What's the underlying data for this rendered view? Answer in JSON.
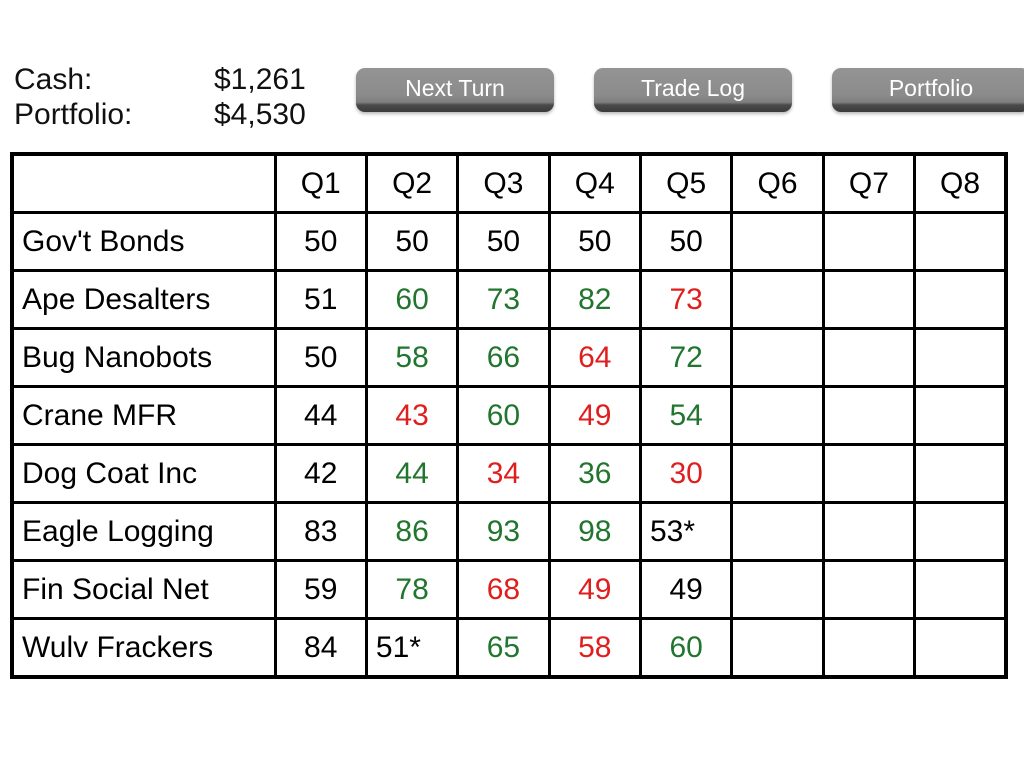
{
  "status": {
    "cash_label": "Cash:",
    "cash_value": "$1,261",
    "portfolio_label": "Portfolio:",
    "portfolio_value": "$4,530"
  },
  "toolbar": {
    "next_turn_label": "Next Turn",
    "trade_log_label": "Trade Log",
    "portfolio_label": "Portfolio"
  },
  "colors": {
    "up": "#22752f",
    "down": "#e01e1e",
    "flat": "#000000",
    "button_face": "#8d8d8d",
    "button_text": "#ffffff",
    "grid": "#000000",
    "background": "#ffffff"
  },
  "table": {
    "corner_header": "",
    "columns": [
      "Q1",
      "Q2",
      "Q3",
      "Q4",
      "Q5",
      "Q6",
      "Q7",
      "Q8"
    ],
    "rows": [
      {
        "name": "Gov't Bonds",
        "cells": [
          {
            "text": "50",
            "trend": "flat"
          },
          {
            "text": "50",
            "trend": "flat"
          },
          {
            "text": "50",
            "trend": "flat"
          },
          {
            "text": "50",
            "trend": "flat"
          },
          {
            "text": "50",
            "trend": "flat"
          },
          {
            "text": "",
            "trend": "empty"
          },
          {
            "text": "",
            "trend": "empty"
          },
          {
            "text": "",
            "trend": "empty"
          }
        ]
      },
      {
        "name": "Ape Desalters",
        "cells": [
          {
            "text": "51",
            "trend": "flat"
          },
          {
            "text": "60",
            "trend": "up"
          },
          {
            "text": "73",
            "trend": "up"
          },
          {
            "text": "82",
            "trend": "up"
          },
          {
            "text": "73",
            "trend": "down"
          },
          {
            "text": "",
            "trend": "empty"
          },
          {
            "text": "",
            "trend": "empty"
          },
          {
            "text": "",
            "trend": "empty"
          }
        ]
      },
      {
        "name": "Bug Nanobots",
        "cells": [
          {
            "text": "50",
            "trend": "flat"
          },
          {
            "text": "58",
            "trend": "up"
          },
          {
            "text": "66",
            "trend": "up"
          },
          {
            "text": "64",
            "trend": "down"
          },
          {
            "text": "72",
            "trend": "up"
          },
          {
            "text": "",
            "trend": "empty"
          },
          {
            "text": "",
            "trend": "empty"
          },
          {
            "text": "",
            "trend": "empty"
          }
        ]
      },
      {
        "name": "Crane MFR",
        "cells": [
          {
            "text": "44",
            "trend": "flat"
          },
          {
            "text": "43",
            "trend": "down"
          },
          {
            "text": "60",
            "trend": "up"
          },
          {
            "text": "49",
            "trend": "down"
          },
          {
            "text": "54",
            "trend": "up"
          },
          {
            "text": "",
            "trend": "empty"
          },
          {
            "text": "",
            "trend": "empty"
          },
          {
            "text": "",
            "trend": "empty"
          }
        ]
      },
      {
        "name": "Dog Coat Inc",
        "cells": [
          {
            "text": "42",
            "trend": "flat"
          },
          {
            "text": "44",
            "trend": "up"
          },
          {
            "text": "34",
            "trend": "down"
          },
          {
            "text": "36",
            "trend": "up"
          },
          {
            "text": "30",
            "trend": "down"
          },
          {
            "text": "",
            "trend": "empty"
          },
          {
            "text": "",
            "trend": "empty"
          },
          {
            "text": "",
            "trend": "empty"
          }
        ]
      },
      {
        "name": "Eagle Logging",
        "cells": [
          {
            "text": "83",
            "trend": "flat"
          },
          {
            "text": "86",
            "trend": "up"
          },
          {
            "text": "93",
            "trend": "up"
          },
          {
            "text": "98",
            "trend": "up"
          },
          {
            "text": "53*",
            "trend": "split"
          },
          {
            "text": "",
            "trend": "empty"
          },
          {
            "text": "",
            "trend": "empty"
          },
          {
            "text": "",
            "trend": "empty"
          }
        ]
      },
      {
        "name": "Fin Social Net",
        "cells": [
          {
            "text": "59",
            "trend": "flat"
          },
          {
            "text": "78",
            "trend": "up"
          },
          {
            "text": "68",
            "trend": "down"
          },
          {
            "text": "49",
            "trend": "down"
          },
          {
            "text": "49",
            "trend": "flat"
          },
          {
            "text": "",
            "trend": "empty"
          },
          {
            "text": "",
            "trend": "empty"
          },
          {
            "text": "",
            "trend": "empty"
          }
        ]
      },
      {
        "name": "Wulv Frackers",
        "cells": [
          {
            "text": "84",
            "trend": "flat"
          },
          {
            "text": "51*",
            "trend": "split"
          },
          {
            "text": "65",
            "trend": "up"
          },
          {
            "text": "58",
            "trend": "down"
          },
          {
            "text": "60",
            "trend": "up"
          },
          {
            "text": "",
            "trend": "empty"
          },
          {
            "text": "",
            "trend": "empty"
          },
          {
            "text": "",
            "trend": "empty"
          }
        ]
      }
    ]
  }
}
